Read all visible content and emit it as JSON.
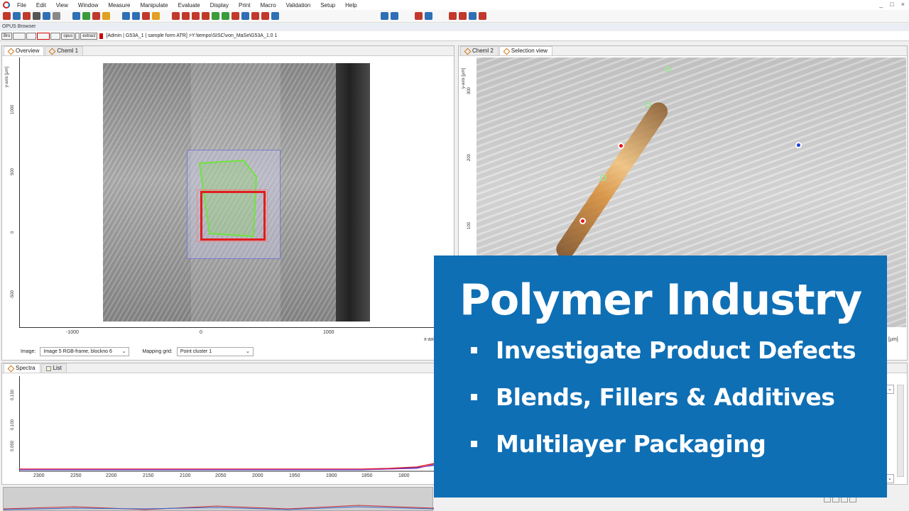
{
  "menu": [
    "File",
    "Edit",
    "View",
    "Window",
    "Measure",
    "Manipulate",
    "Evaluate",
    "Display",
    "Print",
    "Macro",
    "Validation",
    "Setup",
    "Help"
  ],
  "window_controls": [
    "_",
    "□",
    "×"
  ],
  "browser": {
    "title": "OPUS Browser",
    "mini_tabs": [
      "Bro",
      "",
      "",
      "",
      "",
      "opus",
      "",
      "extract"
    ],
    "path": "[Admin | G53A_1 | sample form ATR] >Y:\\tempo\\SISC\\von_MaSe\\G53A_1.0 1"
  },
  "left_panel": {
    "tabs": [
      "Overview",
      "Cheml 1"
    ],
    "y_axis_label": "y-axis [µm]",
    "y_ticks": [
      "1000",
      "500",
      "0",
      "-500"
    ],
    "x_ticks": [
      "-1000",
      "0",
      "1000"
    ],
    "x_axis_label": "x-axis",
    "image_label": "Image:",
    "image_value": "Image 5 RGB-frame, blockno 6",
    "mapping_label": "Mapping grid:",
    "mapping_value": "Point cluster 1"
  },
  "right_panel": {
    "tabs": [
      "Cheml 2",
      "Selection view"
    ],
    "y_axis_label": "y-axis [µm]",
    "y_ticks": [
      "300",
      "200",
      "100"
    ],
    "x_axis_label": "is [µm]"
  },
  "spectra_panel": {
    "tabs": [
      "Spectra",
      "List"
    ],
    "y_ticks": [
      "0.150",
      "0.100",
      "0.050"
    ],
    "x_ticks": [
      "2300",
      "2250",
      "2200",
      "2150",
      "2100",
      "2050",
      "2000",
      "1950",
      "1900",
      "1850",
      "1800"
    ]
  },
  "overlay": {
    "title": "Polymer Industry",
    "bullets": [
      "Investigate Product Defects",
      "Blends, Fillers & Additives",
      "Multilayer Packaging"
    ],
    "bg_color": "#0f6fb5"
  }
}
